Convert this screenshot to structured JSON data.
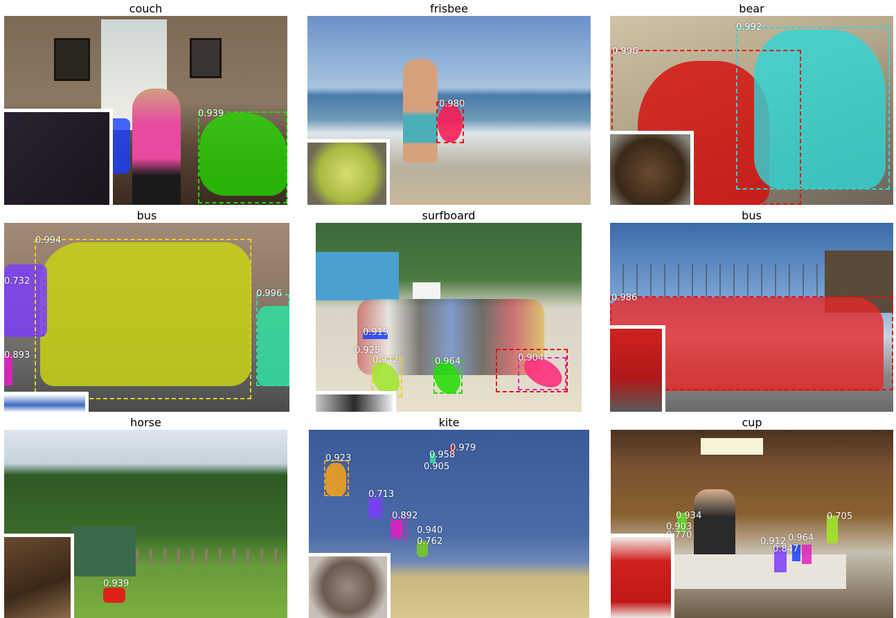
{
  "panels": [
    {
      "title": "couch",
      "scores": [
        "0.939"
      ]
    },
    {
      "title": "frisbee",
      "scores": [
        "0.980"
      ]
    },
    {
      "title": "bear",
      "scores": [
        "0.996",
        "0.992"
      ]
    },
    {
      "title": "bus",
      "scores": [
        "0.994",
        "0.996",
        "0.732",
        "0.893"
      ]
    },
    {
      "title": "surfboard",
      "scores": [
        "0.919",
        "0.925",
        "0.942",
        "0.964",
        "0.904"
      ]
    },
    {
      "title": "bus",
      "scores": [
        "0.986"
      ]
    },
    {
      "title": "horse",
      "scores": [
        "0.939"
      ]
    },
    {
      "title": "kite",
      "scores": [
        "0.979",
        "0.958",
        "0.905",
        "0.923",
        "0.713",
        "0.892",
        "0.940",
        "0.762"
      ]
    },
    {
      "title": "cup",
      "scores": [
        "0.934",
        "0.903",
        "0.770",
        "0.705",
        "0.912",
        "0.847",
        "0.964"
      ]
    }
  ],
  "colors": {
    "green": "#22dd00",
    "red": "#e01010",
    "cyan": "#2fd6d6",
    "yellow": "#e6d21a",
    "purple": "#7a3cff",
    "magenta": "#e020c0",
    "teal": "#30e0a0",
    "orange": "#f0a020",
    "pink": "#ff3080",
    "blue": "#1a40ff"
  }
}
